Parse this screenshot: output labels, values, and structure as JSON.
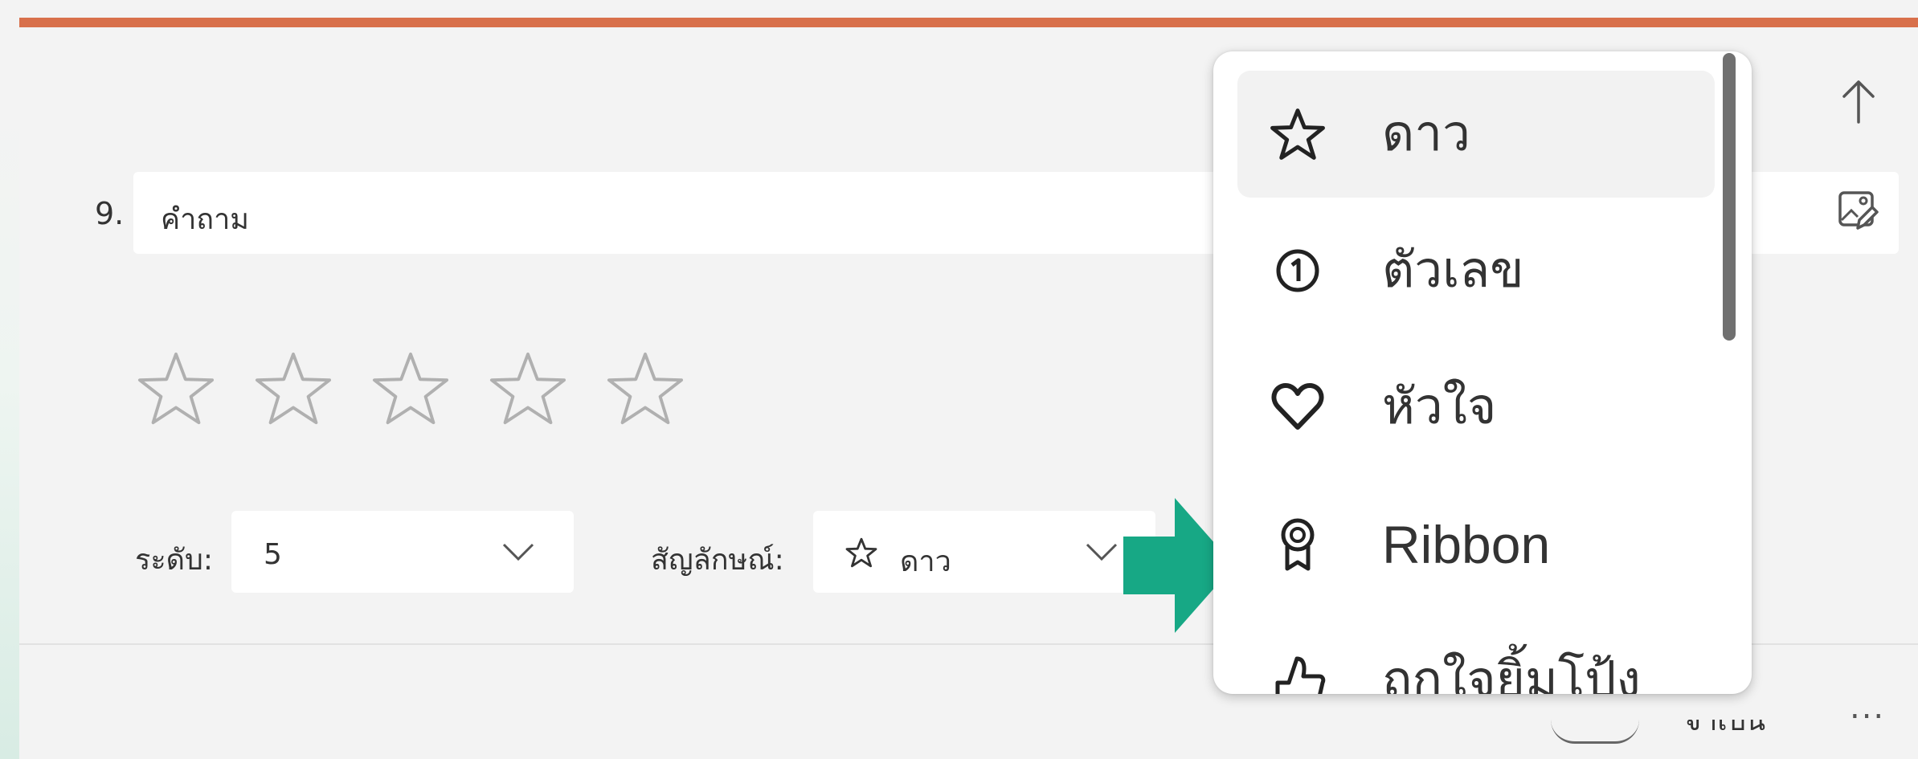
{
  "question": {
    "number": "9.",
    "text": "คำถาม"
  },
  "rating": {
    "star_count": 5,
    "level_label": "ระดับ:",
    "level_value": "5",
    "symbol_label": "สัญลักษณ์:",
    "symbol_value": "ดาว"
  },
  "symbol_menu": {
    "items": [
      {
        "label": "ดาว",
        "icon": "star-icon",
        "selected": true
      },
      {
        "label": "ตัวเลข",
        "icon": "number-one-icon",
        "selected": false
      },
      {
        "label": "หัวใจ",
        "icon": "heart-icon",
        "selected": false
      },
      {
        "label": "Ribbon",
        "icon": "ribbon-icon",
        "selected": false
      },
      {
        "label": "ถูกใจยิ้มโป้ง",
        "icon": "thumb-icon",
        "selected": false
      }
    ]
  },
  "footer": {
    "required_label": "จำเป็น",
    "more_label": "..."
  },
  "colors": {
    "accent_bar": "#d8704b",
    "callout_arrow": "#17a885",
    "card_bg": "#f3f3f3",
    "star_outline": "#b0b0b0"
  }
}
